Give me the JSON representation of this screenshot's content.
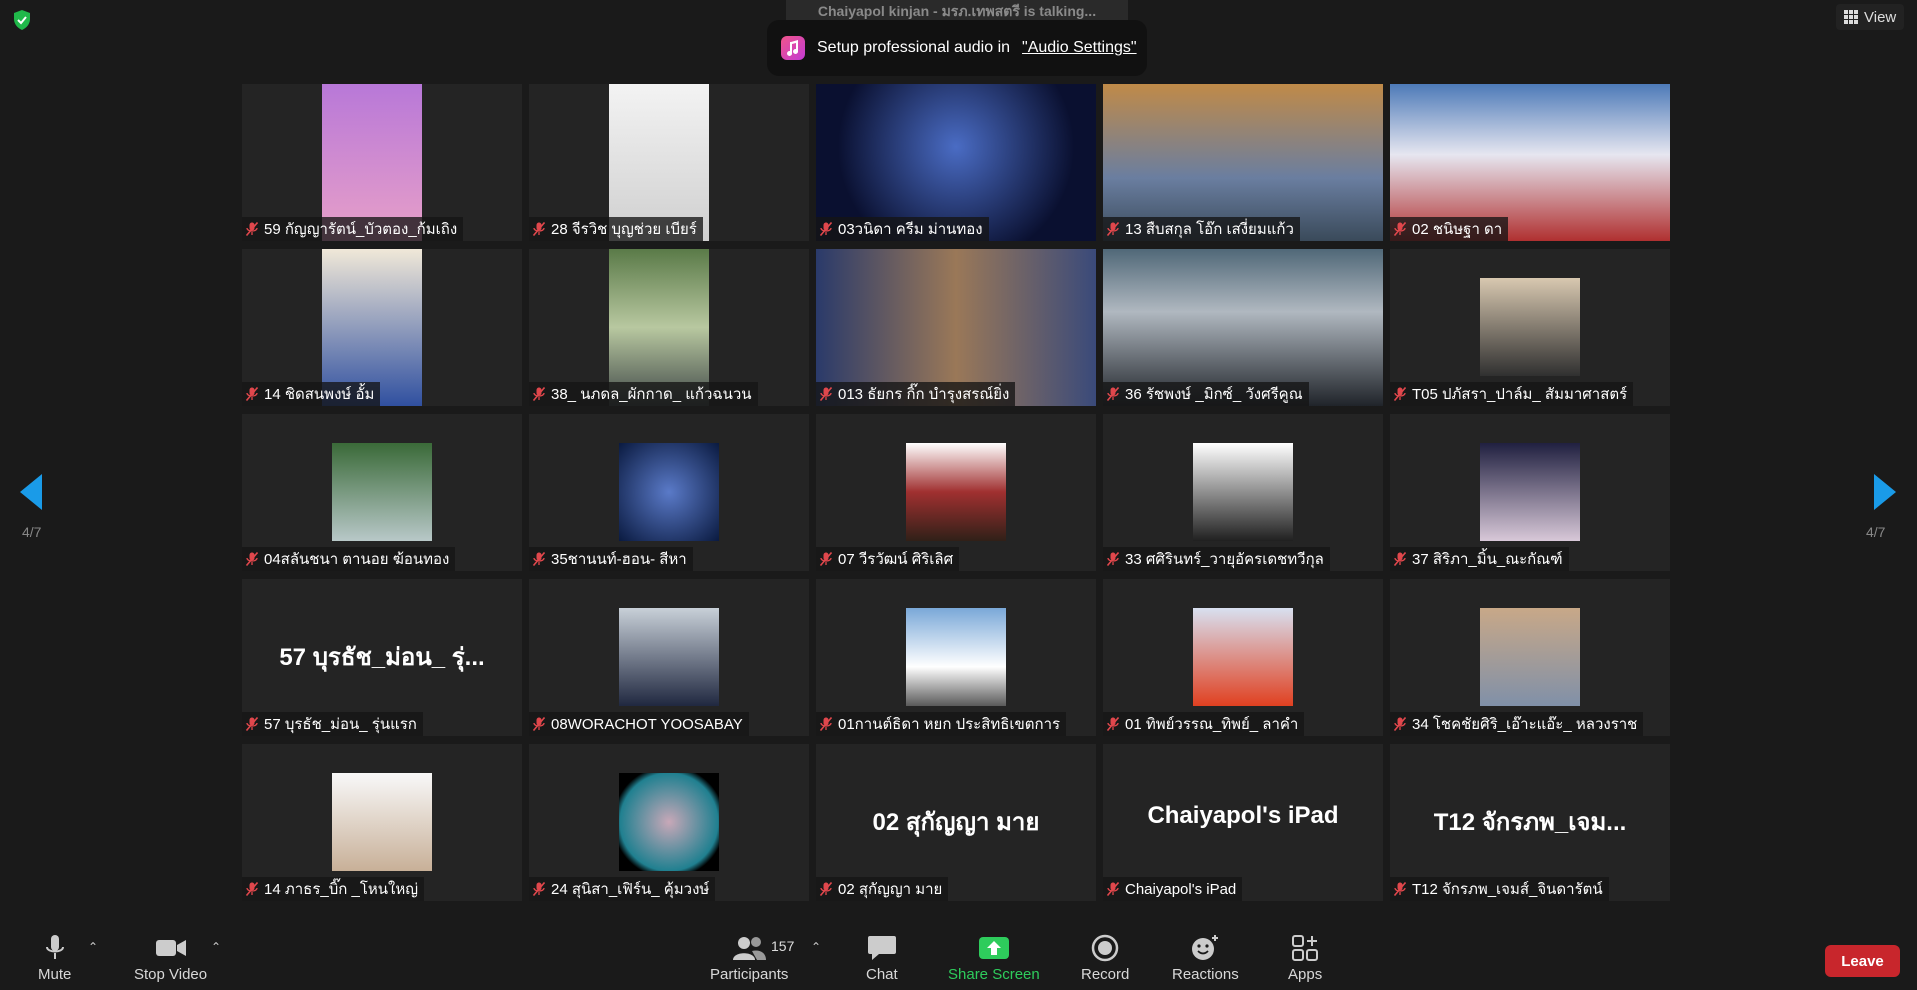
{
  "header": {
    "talking_banner": "Chaiyapol kinjan - มรภ.เทพสตรี is talking...",
    "audio_toast_text": "Setup professional audio in",
    "audio_toast_link": "\"Audio Settings\"",
    "view_label": "View"
  },
  "pagination": {
    "left": "4/7",
    "right": "4/7"
  },
  "participants": [
    {
      "name": "59 กัญญารัตน์_บัวตอง_ก้มเถิง",
      "kind": "video",
      "bg": "linear-gradient(180deg,#b878d8,#e8a0c8)",
      "vl": 80,
      "vw": 100
    },
    {
      "name": "28 จีรวิช บุญช่วย เบียร์",
      "kind": "video",
      "bg": "linear-gradient(180deg,#f3f3f3,#cfcfcf)",
      "vl": 80,
      "vw": 100
    },
    {
      "name": "03วนิดา ครีม ม่านทอง",
      "kind": "video",
      "bg": "radial-gradient(circle at 50% 40%,#4a6cc4,#0a1030 70%)",
      "vl": 0,
      "vw": 280
    },
    {
      "name": "13 สืบสกุล โอ๊ก เสงี่ยมแก้ว",
      "kind": "video",
      "bg": "linear-gradient(180deg,#c08a48,#6a7ea0 60%,#3a4a5a)",
      "vl": 0,
      "vw": 280
    },
    {
      "name": "02 ชนิษฐา ดา",
      "kind": "video",
      "bg": "linear-gradient(180deg,#4d7ab8,#e6e6f0 45%,#b03030)",
      "vl": 0,
      "vw": 280
    },
    {
      "name": "14 ชิดสนพงษ์ อั้ม",
      "kind": "video",
      "bg": "linear-gradient(180deg,#f0e8d8,#3050a0)",
      "vl": 80,
      "vw": 100
    },
    {
      "name": "38_ นภดล_ผักกาด_ แก้วฉนวน",
      "kind": "video",
      "bg": "linear-gradient(180deg,#5a7a48,#b8c8a0 50%,#404848)",
      "vl": 80,
      "vw": 100
    },
    {
      "name": "013 ธัยกร กิ๊ก บำรุงสรณ์ยิ่ง",
      "kind": "video",
      "bg": "linear-gradient(90deg,#2a3a6a,#9a7858 50%,#3a4a7a)",
      "vl": 0,
      "vw": 280
    },
    {
      "name": "36 รัชพงษ์ _มิกซ์_ วังศรีคูณ",
      "kind": "video",
      "bg": "linear-gradient(180deg,#506878,#b0b8c0 40%,#20242a)",
      "vl": 0,
      "vw": 280
    },
    {
      "name": "T05 ปภัสรา_ปาล์ม_ สัมมาศาสตร์",
      "kind": "avatar",
      "bg": "linear-gradient(180deg,#d8c8b0,#303030)"
    },
    {
      "name": "04สลันชนา ตานอย ฆ้อนทอง",
      "kind": "avatar",
      "bg": "linear-gradient(180deg,#3a6a38,#b8c8c8)"
    },
    {
      "name": "35ชานนท์-ฮอน- สีหา",
      "kind": "avatar",
      "bg": "radial-gradient(circle,#5a7ac8,#0a1a40)"
    },
    {
      "name": "07 วีรวัฒน์ ศิริเลิศ",
      "kind": "avatar",
      "bg": "linear-gradient(180deg,#fff,#a03030 50%,#302018)"
    },
    {
      "name": "33 ศศิรินทร์_วายุอัครเดชทวีกุล",
      "kind": "avatar",
      "bg": "linear-gradient(180deg,#ffffff,#202020)"
    },
    {
      "name": "37 สิริภา_มิ้น_ณะกัณฑ์",
      "kind": "avatar",
      "bg": "linear-gradient(180deg,#202040,#d8c8d8)"
    },
    {
      "name": "57 บุรธัช_ม่อน_ รุ่นแรก",
      "kind": "text",
      "bigname": "57 บุรธัช_ม่อน_ รุ่..."
    },
    {
      "name": "08WORACHOT YOOSABAY",
      "kind": "avatar",
      "bg": "linear-gradient(180deg,#c8d0d8,#202840)"
    },
    {
      "name": "01กานต์ธิดา หยก ประสิทธิเขตการ",
      "kind": "avatar",
      "bg": "linear-gradient(180deg,#7aa8d8,#ffffff 60%,#5a5a5a)"
    },
    {
      "name": "01 ทิพย์วรรณ_ทิพย์_ ลาคำ",
      "kind": "avatar",
      "bg": "linear-gradient(180deg,#d8e0f0,#e04020)"
    },
    {
      "name": "34 โชคชัยศิริ_เอ๊าะแอ๊ะ_ หลวงราช",
      "kind": "avatar",
      "bg": "linear-gradient(180deg,#c8a888,#8090a8)"
    },
    {
      "name": "14 ภาธร_บิ๊ก _โหนใหญ่",
      "kind": "avatar",
      "bg": "linear-gradient(180deg,#f8f8f8,#c8b098)"
    },
    {
      "name": "24 สุนิสา_เฟิร์น_ คุ้มวงษ์",
      "kind": "avatar",
      "bg": "radial-gradient(circle,#c8a8b8,#208090 70%,#000 80%)"
    },
    {
      "name": "02 สุกัญญา มาย",
      "kind": "text",
      "bigname": "02 สุกัญญา มาย"
    },
    {
      "name": "Chaiyapol's iPad",
      "kind": "text",
      "bigname": "Chaiyapol's iPad"
    },
    {
      "name": "T12 จักรภพ_เจมส์_จินดารัตน์",
      "kind": "text",
      "bigname": "T12 จักรภพ_เจม..."
    }
  ],
  "toolbar": {
    "mute": "Mute",
    "stop_video": "Stop Video",
    "participants": "Participants",
    "participant_count": "157",
    "chat": "Chat",
    "share_screen": "Share Screen",
    "record": "Record",
    "reactions": "Reactions",
    "apps": "Apps",
    "leave": "Leave"
  },
  "colors": {
    "share_green": "#2ecc5c",
    "leave_red": "#c8262c",
    "nav_blue": "#1a9be8",
    "mute_red": "#e0474c"
  }
}
